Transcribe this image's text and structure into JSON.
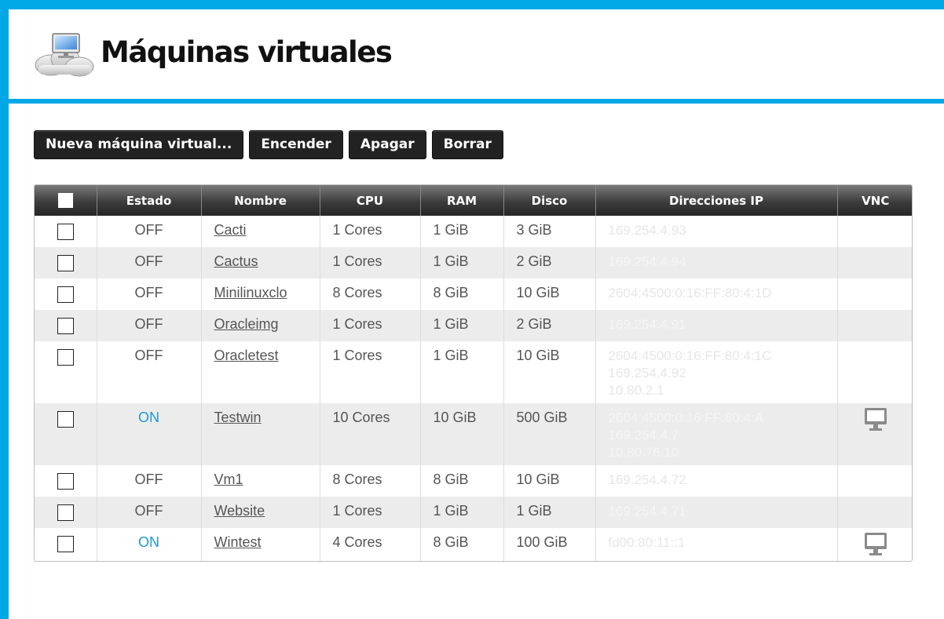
{
  "header": {
    "title": "Máquinas virtuales"
  },
  "toolbar": {
    "new_label": "Nueva máquina virtual...",
    "power_on_label": "Encender",
    "power_off_label": "Apagar",
    "delete_label": "Borrar"
  },
  "table": {
    "columns": [
      "Estado",
      "Nombre",
      "CPU",
      "RAM",
      "Disco",
      "Direcciones IP",
      "VNC"
    ],
    "rows": [
      {
        "state": "OFF",
        "name": "Cacti",
        "cpu": "1 Cores",
        "ram": "1 GiB",
        "disk": "3 GiB",
        "ips": [
          "169.254.4.93"
        ],
        "vnc": false
      },
      {
        "state": "OFF",
        "name": "Cactus",
        "cpu": "1 Cores",
        "ram": "1 GiB",
        "disk": "2 GiB",
        "ips": [
          "169.254.4.94"
        ],
        "vnc": false
      },
      {
        "state": "OFF",
        "name": "Minilinuxclo",
        "cpu": "8 Cores",
        "ram": "8 GiB",
        "disk": "10 GiB",
        "ips": [
          "2604:4500:0:16:FF:80:4:1D"
        ],
        "vnc": false
      },
      {
        "state": "OFF",
        "name": "Oracleimg",
        "cpu": "1 Cores",
        "ram": "1 GiB",
        "disk": "2 GiB",
        "ips": [
          "169.254.4.91"
        ],
        "vnc": false
      },
      {
        "state": "OFF",
        "name": "Oracletest",
        "cpu": "1 Cores",
        "ram": "1 GiB",
        "disk": "10 GiB",
        "ips": [
          "2604:4500:0:16:FF:80:4:1C",
          "169.254.4.92",
          "10.80.2.1"
        ],
        "vnc": false
      },
      {
        "state": "ON",
        "name": "Testwin",
        "cpu": "10 Cores",
        "ram": "10 GiB",
        "disk": "500 GiB",
        "ips": [
          "2604:4500:0:16:FF:80:4:A",
          "169.254.4.7",
          "10.80.76.10"
        ],
        "vnc": true
      },
      {
        "state": "OFF",
        "name": "Vm1",
        "cpu": "8 Cores",
        "ram": "8 GiB",
        "disk": "10 GiB",
        "ips": [
          "169.254.4.72"
        ],
        "vnc": false
      },
      {
        "state": "OFF",
        "name": "Website",
        "cpu": "1 Cores",
        "ram": "1 GiB",
        "disk": "1 GiB",
        "ips": [
          "169.254.4.71"
        ],
        "vnc": false
      },
      {
        "state": "ON",
        "name": "Wintest",
        "cpu": "4 Cores",
        "ram": "8 GiB",
        "disk": "100 GiB",
        "ips": [
          "fd00:80:11::1"
        ],
        "vnc": true
      }
    ]
  },
  "icons": {
    "logo": "cloud-computer-icon",
    "vnc": "monitor-icon"
  },
  "colors": {
    "frame": "#00a8e6",
    "state_on": "#1a9ad6",
    "button_bg": "#222222"
  }
}
